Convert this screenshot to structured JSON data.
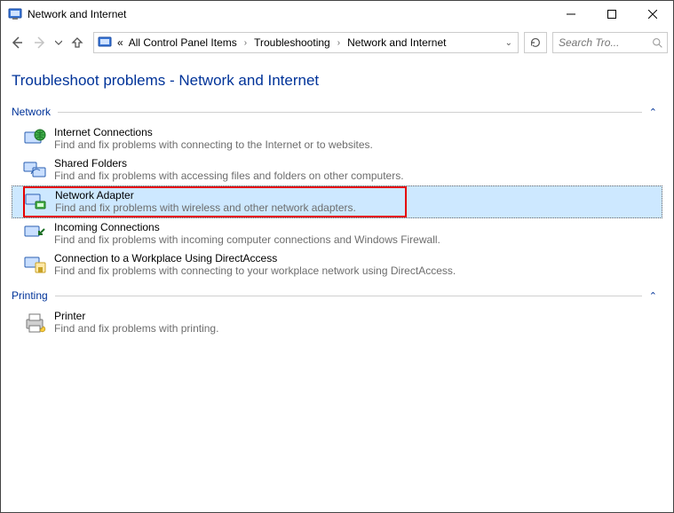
{
  "window": {
    "title": "Network and Internet"
  },
  "nav": {
    "crumbs": [
      "All Control Panel Items",
      "Troubleshooting",
      "Network and Internet"
    ],
    "ellipsis": "«"
  },
  "search": {
    "placeholder": "Search Tro..."
  },
  "page": {
    "heading": "Troubleshoot problems - Network and Internet"
  },
  "sections": {
    "network": {
      "title": "Network",
      "items": [
        {
          "title": "Internet Connections",
          "desc": "Find and fix problems with connecting to the Internet or to websites."
        },
        {
          "title": "Shared Folders",
          "desc": "Find and fix problems with accessing files and folders on other computers."
        },
        {
          "title": "Network Adapter",
          "desc": "Find and fix problems with wireless and other network adapters."
        },
        {
          "title": "Incoming Connections",
          "desc": "Find and fix problems with incoming computer connections and Windows Firewall."
        },
        {
          "title": "Connection to a Workplace Using DirectAccess",
          "desc": "Find and fix problems with connecting to your workplace network using DirectAccess."
        }
      ]
    },
    "printing": {
      "title": "Printing",
      "items": [
        {
          "title": "Printer",
          "desc": "Find and fix problems with printing."
        }
      ]
    }
  }
}
